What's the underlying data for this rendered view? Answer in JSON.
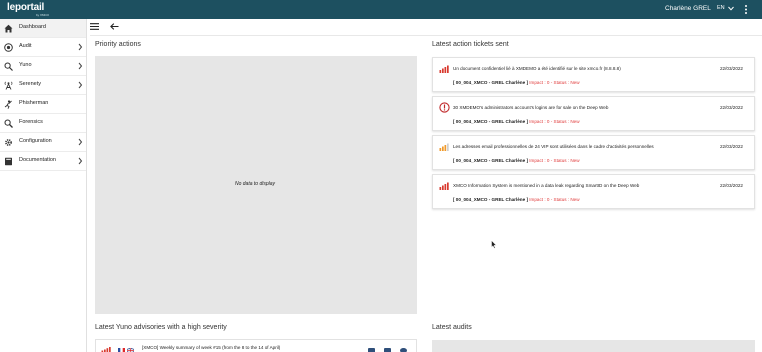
{
  "app": {
    "logo": "leportail",
    "logo_sub": "by XMCO",
    "user_name": "Charlène GREL",
    "language": "EN"
  },
  "sidebar": {
    "items": [
      {
        "label": "Dashboard",
        "icon": "home-icon",
        "has_submenu": false
      },
      {
        "label": "Audit",
        "icon": "audit-icon",
        "has_submenu": true
      },
      {
        "label": "Yuno",
        "icon": "yuno-icon",
        "has_submenu": true
      },
      {
        "label": "Serenety",
        "icon": "antenna-icon",
        "has_submenu": true
      },
      {
        "label": "Phisherman",
        "icon": "phisherman-icon",
        "has_submenu": false
      },
      {
        "label": "Forensics",
        "icon": "magnifier-icon",
        "has_submenu": false
      },
      {
        "label": "Configuration",
        "icon": "gear-icon",
        "has_submenu": true
      },
      {
        "label": "Documentation",
        "icon": "book-icon",
        "has_submenu": true
      }
    ]
  },
  "sections": {
    "priority_actions": {
      "title": "Priority actions",
      "empty_text": "No data to display"
    },
    "latest_tickets": {
      "title": "Latest action tickets sent"
    },
    "yuno_advisories": {
      "title": "Latest Yuno advisories with a high severity"
    },
    "latest_audits": {
      "title": "Latest audits"
    }
  },
  "tickets": [
    {
      "icon": "severity-high-icon",
      "text": "Un document confidentiel lié à XMDEMO a été identifié sur le site xmco.fr (8.8.8.8)",
      "date": "22/03/2022",
      "ref": "[ 00_004_XMCO - GREL Charlène ]",
      "status": "Impact : 0 - Status : New"
    },
    {
      "icon": "warning-circle-icon",
      "text": "30 XMDEMO's administrators account's logins are for sale on the Deep Web",
      "date": "22/03/2022",
      "ref": "[ 00_004_XMCO - GREL Charlène ]",
      "status": "Impact : 0 - Status : New"
    },
    {
      "icon": "severity-medium-icon",
      "text": "Les adresses email professionnelles de 24 VIP sont utilisées dans le cadre d'activités personnelles",
      "date": "22/03/2022",
      "ref": "[ 00_004_XMCO - GREL Charlène ]",
      "status": "Impact : 0 - Status : New"
    },
    {
      "icon": "severity-high-icon",
      "text": "XMCO Information System is mentioned in a data leak regarding SmartID on the Deep Web",
      "date": "22/03/2022",
      "ref": "[ 00_004_XMCO - GREL Charlène ]",
      "status": "Impact : 0 - Status : New"
    }
  ],
  "yuno_rows": [
    {
      "text": "[XMCO] Weekly summary of week #15 (from the 8 to the 14 of April)"
    }
  ],
  "colors": {
    "topbar": "#1d5060",
    "panel_gray": "#e6e6e6",
    "status_red": "#e03a3a",
    "severity_red": "#d93a2f",
    "severity_orange": "#f09a2a"
  }
}
